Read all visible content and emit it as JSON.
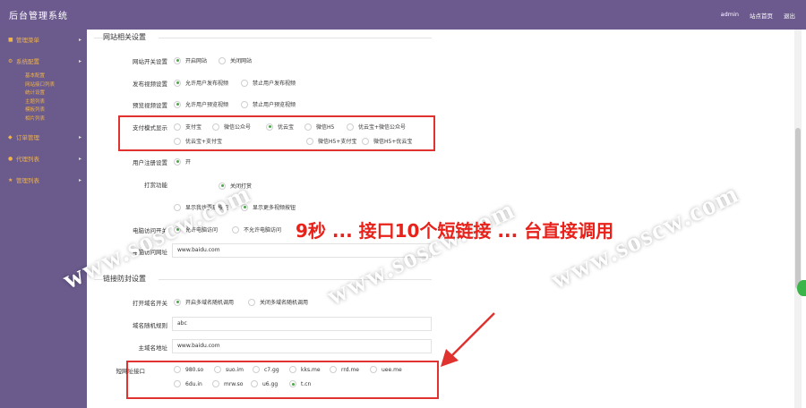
{
  "topbar": {
    "title": "后台管理系统",
    "links": [
      "admin",
      "站点首页",
      "退出"
    ]
  },
  "sidebar": {
    "items": [
      {
        "label": "管理菜单",
        "icon": "home-icon"
      },
      {
        "label": "系统配置",
        "icon": "gear-icon"
      }
    ],
    "submenu": [
      "基本配置",
      "网站接口列表",
      "统计设置",
      "主题列表",
      "模板列表",
      "相片列表"
    ],
    "bottom_items": [
      {
        "label": "订单管理",
        "icon": "cart-icon"
      },
      {
        "label": "代理列表",
        "icon": "user-icon"
      },
      {
        "label": "管理列表",
        "icon": "star-icon"
      }
    ]
  },
  "section1": {
    "title": "网站相关设置",
    "rows": [
      {
        "label": "网站开关设置",
        "options": [
          "开启网站",
          "关闭网站"
        ],
        "selected": 0
      },
      {
        "label": "发布视频设置",
        "options": [
          "允许用户发布视频",
          "禁止用户发布视频"
        ],
        "selected": 0
      },
      {
        "label": "预览视频设置",
        "options": [
          "允许用户预览视频",
          "禁止用户预览视频"
        ],
        "selected": 0
      }
    ],
    "pay_label": "支付模式显示",
    "pay_options_row1": [
      "支付宝",
      "微信公众号",
      "优云宝",
      "微信H5",
      "优云宝+微信公众号"
    ],
    "pay_options_row2": [
      "优云宝+支付宝",
      "...",
      "...",
      "微信H5+支付宝",
      "微信H5+优云宝"
    ],
    "pay_selected": 2,
    "row_user": {
      "label": "用户注册设置",
      "options": [
        "开"
      ]
    },
    "row_open": {
      "label": "打赏功能"
    },
    "row_open_sub": {
      "options": [
        "关闭打赏"
      ]
    },
    "row_display": {
      "options": [
        "显示我也要玩按钮",
        "显示更多视频按钮"
      ],
      "selected": 1
    },
    "row_access": {
      "label": "电脑访问开关",
      "options": [
        "允许电脑访问",
        "不允许电脑访问"
      ],
      "selected": 0
    },
    "pc_url": {
      "label": "电脑访问网址",
      "value": "www.baidu.com"
    }
  },
  "section2": {
    "title": "链接防封设置",
    "rand": {
      "label": "打开域名开关",
      "options": [
        "开启多域名随机调用",
        "关闭多域名随机调用"
      ],
      "selected": 0
    },
    "rand_rule": {
      "label": "域名随机规则",
      "value": "abc"
    },
    "main_domain": {
      "label": "主域名地址",
      "value": "www.baidu.com"
    },
    "short_label": "短网址接口",
    "short_row1": [
      "980.so",
      "suo.im",
      "c7.gg",
      "kks.me",
      "rrd.me",
      "uee.me"
    ],
    "short_row2": [
      "6du.in",
      "mrw.so",
      "u6.gg",
      "t.cn"
    ],
    "short_selected": "t.cn"
  },
  "watermarks": {
    "text": "www.soscw.com",
    "center": "9秒 ... 接口10个短链接 ... 台直接调用"
  },
  "colors": {
    "topbar": "#6c5a8e",
    "sidebar": "#6a5b8c",
    "accent": "#f0b24b",
    "red": "#e0332f",
    "green": "#4aa84a"
  }
}
